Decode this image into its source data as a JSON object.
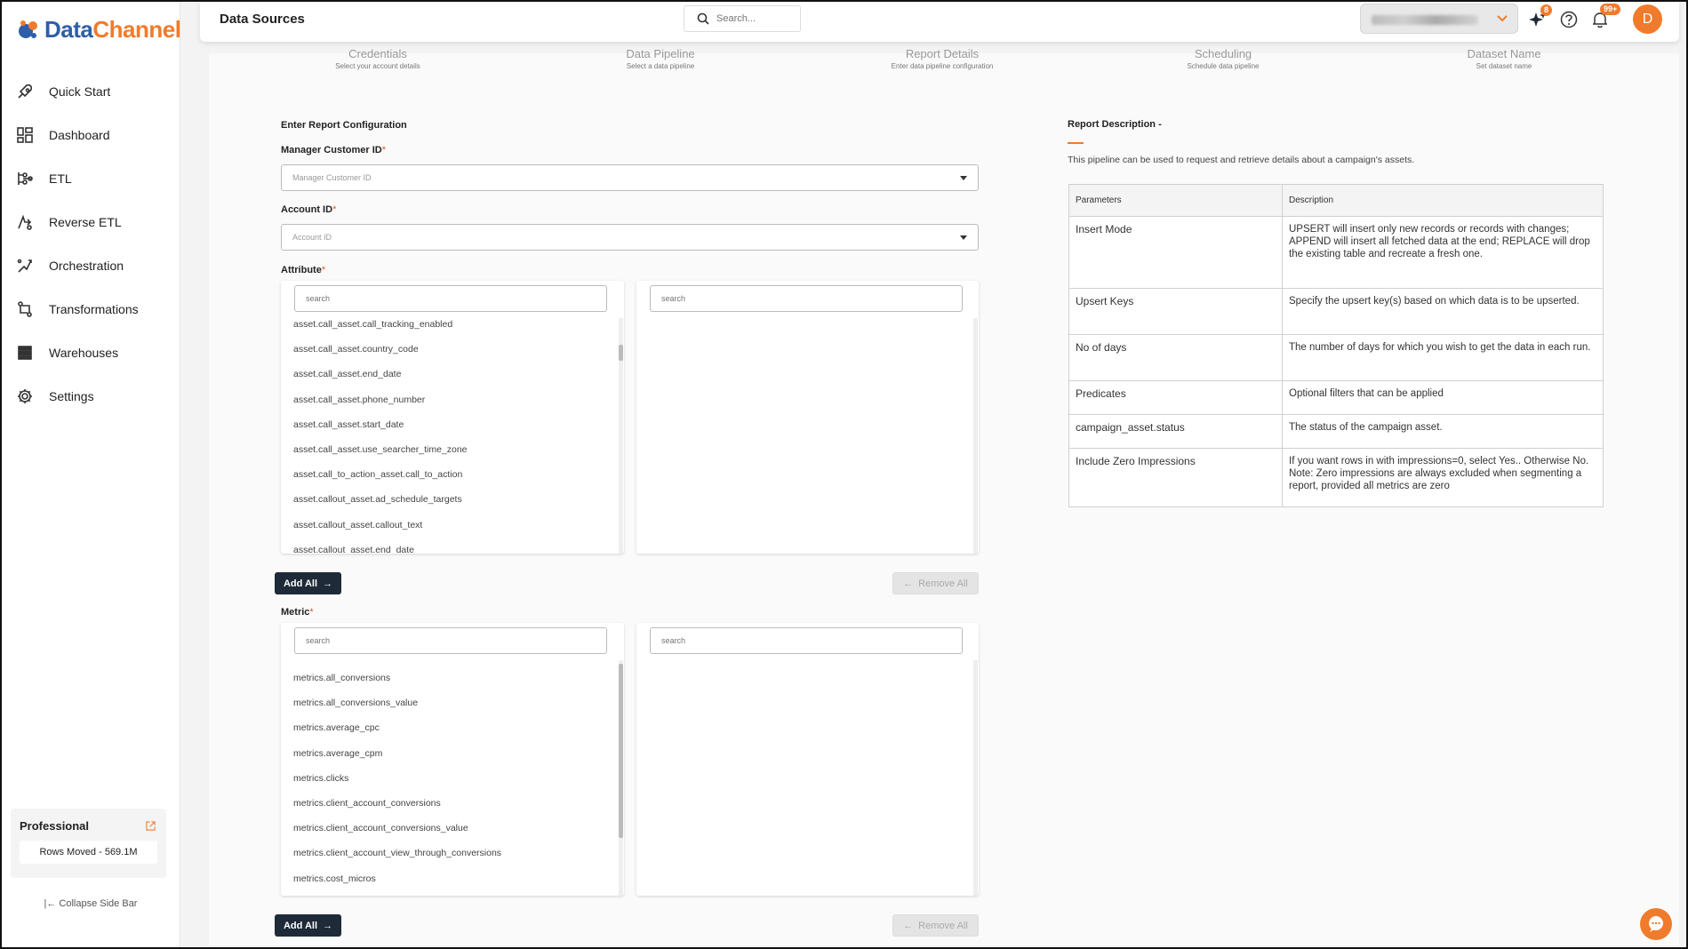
{
  "brand": {
    "logo_part1": "Data",
    "logo_part2": "Channel"
  },
  "sidebar": {
    "items": [
      {
        "label": "Quick Start",
        "icon": "rocket-icon"
      },
      {
        "label": "Dashboard",
        "icon": "dashboard-icon"
      },
      {
        "label": "ETL",
        "icon": "etl-icon"
      },
      {
        "label": "Reverse ETL",
        "icon": "reverse-etl-icon"
      },
      {
        "label": "Orchestration",
        "icon": "orchestration-icon"
      },
      {
        "label": "Transformations",
        "icon": "transformations-icon"
      },
      {
        "label": "Warehouses",
        "icon": "warehouses-icon"
      },
      {
        "label": "Settings",
        "icon": "gear-icon"
      }
    ],
    "plan": {
      "title": "Professional",
      "rows_moved": "Rows Moved - 569.1M"
    },
    "collapse_label": "Collapse Side Bar"
  },
  "header": {
    "title": "Data Sources",
    "search_placeholder": "Search...",
    "notifications_ai_badge": "8",
    "notifications_badge": "99+",
    "avatar_initial": "D"
  },
  "steps": [
    {
      "label": "Credentials",
      "sub": "Select your account details"
    },
    {
      "label": "Data Pipeline",
      "sub": "Select a data pipeline"
    },
    {
      "label": "Report Details",
      "sub": "Enter data pipeline configuration"
    },
    {
      "label": "Scheduling",
      "sub": "Schedule data pipeline"
    },
    {
      "label": "Dataset Name",
      "sub": "Set dataset name"
    }
  ],
  "form": {
    "section_title": "Enter Report Configuration",
    "manager_label": "Manager Customer ID",
    "manager_placeholder": "Manager Customer ID",
    "account_label": "Account ID",
    "account_placeholder": "Account ID",
    "required_mark": "*",
    "attribute_label": "Attribute",
    "metric_label": "Metric",
    "search_placeholder": "search",
    "add_all_label": "Add All",
    "remove_all_label": "Remove All",
    "attributes": [
      "asset.call_asset.call_tracking_enabled",
      "asset.call_asset.country_code",
      "asset.call_asset.end_date",
      "asset.call_asset.phone_number",
      "asset.call_asset.start_date",
      "asset.call_asset.use_searcher_time_zone",
      "asset.call_to_action_asset.call_to_action",
      "asset.callout_asset.ad_schedule_targets",
      "asset.callout_asset.callout_text",
      "asset.callout_asset.end_date"
    ],
    "metrics": [
      "metrics.all_conversions",
      "metrics.all_conversions_value",
      "metrics.average_cpc",
      "metrics.average_cpm",
      "metrics.clicks",
      "metrics.client_account_conversions",
      "metrics.client_account_conversions_value",
      "metrics.client_account_view_through_conversions",
      "metrics.cost_micros"
    ]
  },
  "description": {
    "title": "Report Description -",
    "text": "This pipeline can be used to request and retrieve details about a campaign's assets.",
    "col_params": "Parameters",
    "col_desc": "Description",
    "rows": [
      {
        "param": "Insert Mode",
        "desc": "UPSERT will insert only new records or records with changes; APPEND will insert all fetched data at the end; REPLACE will drop the existing table and recreate a fresh one."
      },
      {
        "param": "Upsert Keys",
        "desc": "Specify the upsert key(s) based on which data is to be upserted."
      },
      {
        "param": "No of days",
        "desc": "The number of days for which you wish to get the data in each run."
      },
      {
        "param": "Predicates",
        "desc": "Optional filters that can be applied"
      },
      {
        "param": "campaign_asset.status",
        "desc": "The status of the campaign asset."
      },
      {
        "param": "Include Zero Impressions",
        "desc": "If you want rows in with impressions=0, select Yes.. Otherwise No. Note: Zero impressions are always excluded when segmenting a report, provided all metrics are zero"
      }
    ]
  },
  "colors": {
    "accent": "#f07b2c",
    "brand_blue": "#2d5fa8",
    "button_dark": "#1e2a38"
  }
}
